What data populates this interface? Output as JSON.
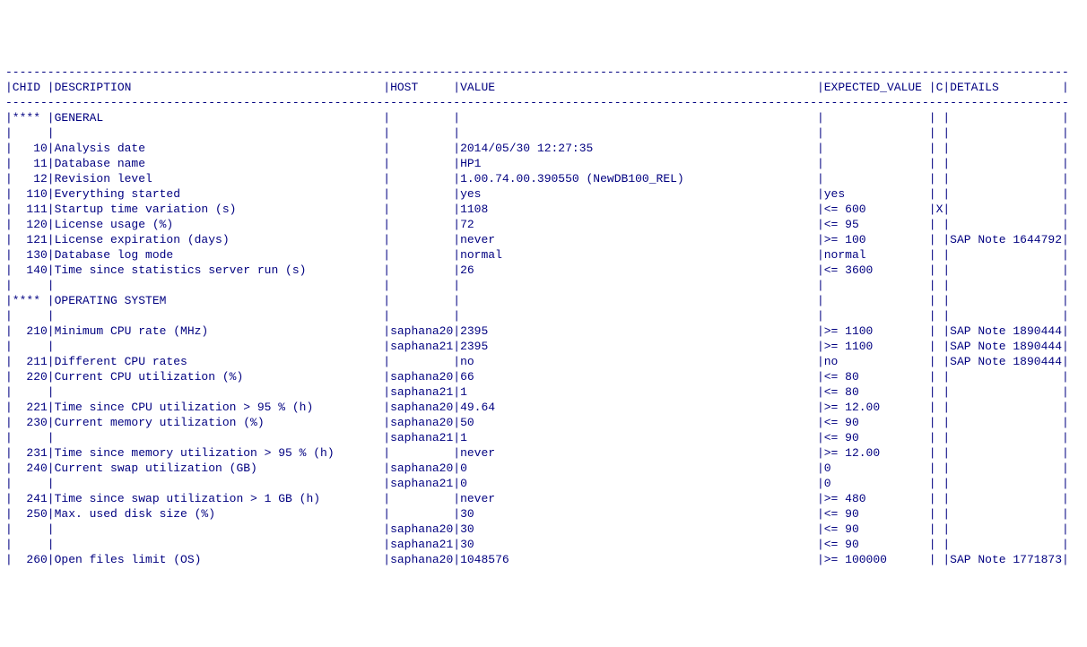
{
  "widths": {
    "chid": 5,
    "description": 47,
    "host": 9,
    "value": 51,
    "expected": 15,
    "c": 1,
    "details": 16
  },
  "headers": {
    "chid": "CHID",
    "description": "DESCRIPTION",
    "host": "HOST",
    "value": "VALUE",
    "expected": "EXPECTED_VALUE",
    "c": "C",
    "details": "DETAILS"
  },
  "rows": [
    {
      "type": "dash"
    },
    {
      "type": "head"
    },
    {
      "type": "dash"
    },
    {
      "type": "sect",
      "chid": "****",
      "desc": "GENERAL"
    },
    {
      "type": "empty"
    },
    {
      "type": "data",
      "chid": "10",
      "desc": "Analysis date",
      "host": "",
      "value": "2014/05/30 12:27:35",
      "exp": "",
      "c": "",
      "det": ""
    },
    {
      "type": "data",
      "chid": "11",
      "desc": "Database name",
      "host": "",
      "value": "HP1",
      "exp": "",
      "c": "",
      "det": ""
    },
    {
      "type": "data",
      "chid": "12",
      "desc": "Revision level",
      "host": "",
      "value": "1.00.74.00.390550 (NewDB100_REL)",
      "exp": "",
      "c": "",
      "det": ""
    },
    {
      "type": "data",
      "chid": "110",
      "desc": "Everything started",
      "host": "",
      "value": "yes",
      "exp": "yes",
      "c": "",
      "det": ""
    },
    {
      "type": "data",
      "chid": "111",
      "desc": "Startup time variation (s)",
      "host": "",
      "value": "1108",
      "exp": "<= 600",
      "c": "X",
      "det": ""
    },
    {
      "type": "data",
      "chid": "120",
      "desc": "License usage (%)",
      "host": "",
      "value": "72",
      "exp": "<= 95",
      "c": "",
      "det": ""
    },
    {
      "type": "data",
      "chid": "121",
      "desc": "License expiration (days)",
      "host": "",
      "value": "never",
      "exp": ">= 100",
      "c": "",
      "det": "SAP Note 1644792"
    },
    {
      "type": "data",
      "chid": "130",
      "desc": "Database log mode",
      "host": "",
      "value": "normal",
      "exp": "normal",
      "c": "",
      "det": ""
    },
    {
      "type": "data",
      "chid": "140",
      "desc": "Time since statistics server run (s)",
      "host": "",
      "value": "26",
      "exp": "<= 3600",
      "c": "",
      "det": ""
    },
    {
      "type": "empty"
    },
    {
      "type": "sect",
      "chid": "****",
      "desc": "OPERATING SYSTEM"
    },
    {
      "type": "empty"
    },
    {
      "type": "data",
      "chid": "210",
      "desc": "Minimum CPU rate (MHz)",
      "host": "saphana20",
      "value": "2395",
      "exp": ">= 1100",
      "c": "",
      "det": "SAP Note 1890444"
    },
    {
      "type": "data",
      "chid": "",
      "desc": "",
      "host": "saphana21",
      "value": "2395",
      "exp": ">= 1100",
      "c": "",
      "det": "SAP Note 1890444"
    },
    {
      "type": "data",
      "chid": "211",
      "desc": "Different CPU rates",
      "host": "",
      "value": "no",
      "exp": "no",
      "c": "",
      "det": "SAP Note 1890444"
    },
    {
      "type": "data",
      "chid": "220",
      "desc": "Current CPU utilization (%)",
      "host": "saphana20",
      "value": "66",
      "exp": "<= 80",
      "c": "",
      "det": ""
    },
    {
      "type": "data",
      "chid": "",
      "desc": "",
      "host": "saphana21",
      "value": "1",
      "exp": "<= 80",
      "c": "",
      "det": ""
    },
    {
      "type": "data",
      "chid": "221",
      "desc": "Time since CPU utilization > 95 % (h)",
      "host": "saphana20",
      "value": "49.64",
      "exp": ">= 12.00",
      "c": "",
      "det": ""
    },
    {
      "type": "data",
      "chid": "230",
      "desc": "Current memory utilization (%)",
      "host": "saphana20",
      "value": "50",
      "exp": "<= 90",
      "c": "",
      "det": ""
    },
    {
      "type": "data",
      "chid": "",
      "desc": "",
      "host": "saphana21",
      "value": "1",
      "exp": "<= 90",
      "c": "",
      "det": ""
    },
    {
      "type": "data",
      "chid": "231",
      "desc": "Time since memory utilization > 95 % (h)",
      "host": "",
      "value": "never",
      "exp": ">= 12.00",
      "c": "",
      "det": ""
    },
    {
      "type": "data",
      "chid": "240",
      "desc": "Current swap utilization (GB)",
      "host": "saphana20",
      "value": "0",
      "exp": "0",
      "c": "",
      "det": ""
    },
    {
      "type": "data",
      "chid": "",
      "desc": "",
      "host": "saphana21",
      "value": "0",
      "exp": "0",
      "c": "",
      "det": ""
    },
    {
      "type": "data",
      "chid": "241",
      "desc": "Time since swap utilization > 1 GB (h)",
      "host": "",
      "value": "never",
      "exp": ">= 480",
      "c": "",
      "det": ""
    },
    {
      "type": "data",
      "chid": "250",
      "desc": "Max. used disk size (%)",
      "host": "",
      "value": "30",
      "exp": "<= 90",
      "c": "",
      "det": ""
    },
    {
      "type": "data",
      "chid": "",
      "desc": "",
      "host": "saphana20",
      "value": "30",
      "exp": "<= 90",
      "c": "",
      "det": ""
    },
    {
      "type": "data",
      "chid": "",
      "desc": "",
      "host": "saphana21",
      "value": "30",
      "exp": "<= 90",
      "c": "",
      "det": ""
    },
    {
      "type": "data",
      "chid": "260",
      "desc": "Open files limit (OS)",
      "host": "saphana20",
      "value": "1048576",
      "exp": ">= 100000",
      "c": "",
      "det": "SAP Note 1771873"
    }
  ]
}
